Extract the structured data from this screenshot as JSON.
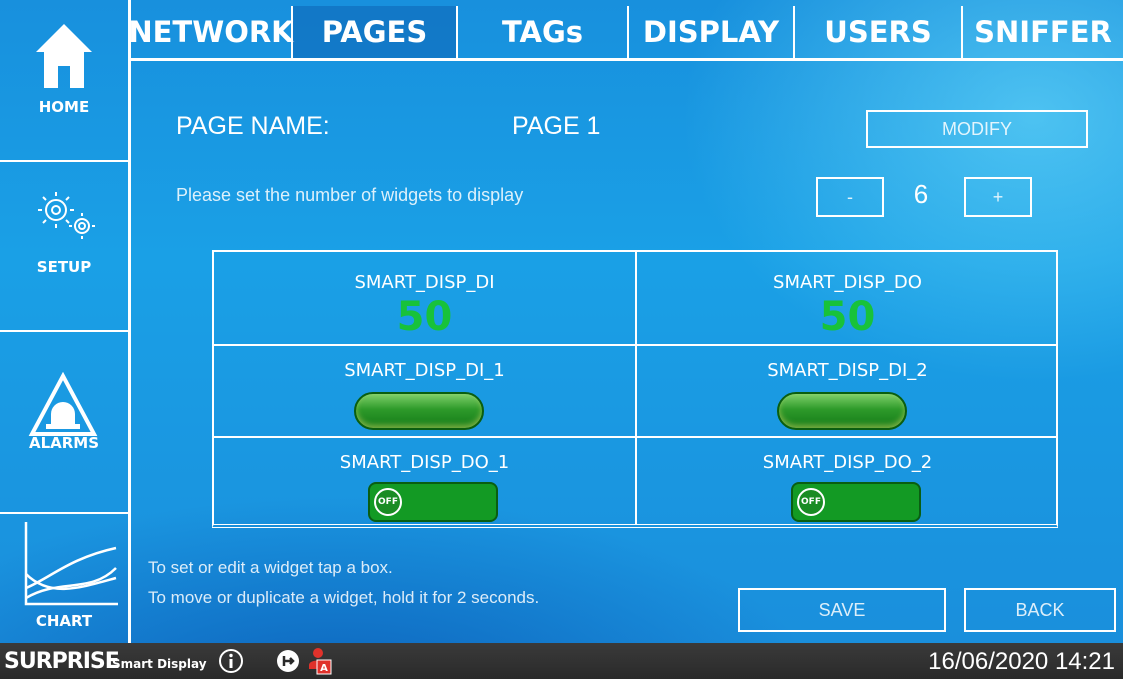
{
  "sidebar": {
    "items": [
      {
        "label": "HOME",
        "icon": "home-icon"
      },
      {
        "label": "SETUP",
        "icon": "gears-icon"
      },
      {
        "label": "ALARMS",
        "icon": "alarm-beacon-icon"
      },
      {
        "label": "CHART",
        "icon": "chart-icon"
      }
    ]
  },
  "tabs": [
    {
      "label": "NETWORK"
    },
    {
      "label": "PAGES"
    },
    {
      "label": "TAGs"
    },
    {
      "label": "DISPLAY"
    },
    {
      "label": "USERS"
    },
    {
      "label": "SNIFFER"
    }
  ],
  "active_tab": "PAGES",
  "page": {
    "name_label": "PAGE NAME:",
    "name_value": "PAGE 1",
    "modify_label": "MODIFY",
    "instruction": "Please set the number of widgets to display",
    "minus_label": "-",
    "plus_label": "+",
    "widget_count": "6"
  },
  "widgets": [
    {
      "title": "SMART_DISP_DI",
      "type": "value",
      "value": "50"
    },
    {
      "title": "SMART_DISP_DO",
      "type": "value",
      "value": "50"
    },
    {
      "title": "SMART_DISP_DI_1",
      "type": "led"
    },
    {
      "title": "SMART_DISP_DI_2",
      "type": "led"
    },
    {
      "title": "SMART_DISP_DO_1",
      "type": "toggle",
      "state": "OFF"
    },
    {
      "title": "SMART_DISP_DO_2",
      "type": "toggle",
      "state": "OFF"
    }
  ],
  "hints": {
    "line1": "To set or edit a widget tap a box.",
    "line2": "To move or duplicate a widget, hold it for 2 seconds."
  },
  "actions": {
    "save_label": "SAVE",
    "back_label": "BACK"
  },
  "statusbar": {
    "brand": "SURPRISE",
    "brand_sub": "Smart Display",
    "datetime": "16/06/2020 14:21",
    "icons": [
      "info-icon",
      "logout-icon",
      "user-admin-icon"
    ]
  },
  "colors": {
    "background": "#1a9ae4",
    "value_green": "#18c23a",
    "toggle_green": "#139a24",
    "statusbar": "#333333"
  }
}
